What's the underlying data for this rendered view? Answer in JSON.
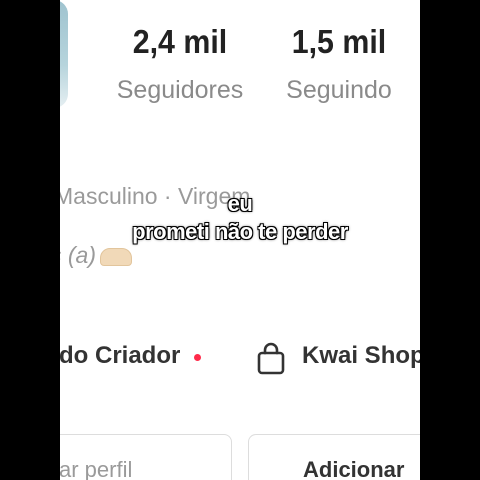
{
  "profile": {
    "followers": {
      "count": "2,4 mil",
      "label": "Seguidores"
    },
    "following": {
      "count": "1,5 mil",
      "label": "Seguindo"
    },
    "bio_line": "Masculino · Virgem",
    "bio_line2": "s (a)"
  },
  "subtitles": {
    "line1": "eu",
    "line2": "prometi não te perder"
  },
  "actions": {
    "creator_label": "do Criador",
    "shop_label": "Kwai Shop",
    "edit_profile_label": "ar perfil",
    "add_label": "Adicionar"
  },
  "colors": {
    "notification_dot": "#ff2a4a"
  },
  "icons": {
    "shop": "shopping-bag-icon",
    "emoji": "hands-emoji-icon"
  }
}
